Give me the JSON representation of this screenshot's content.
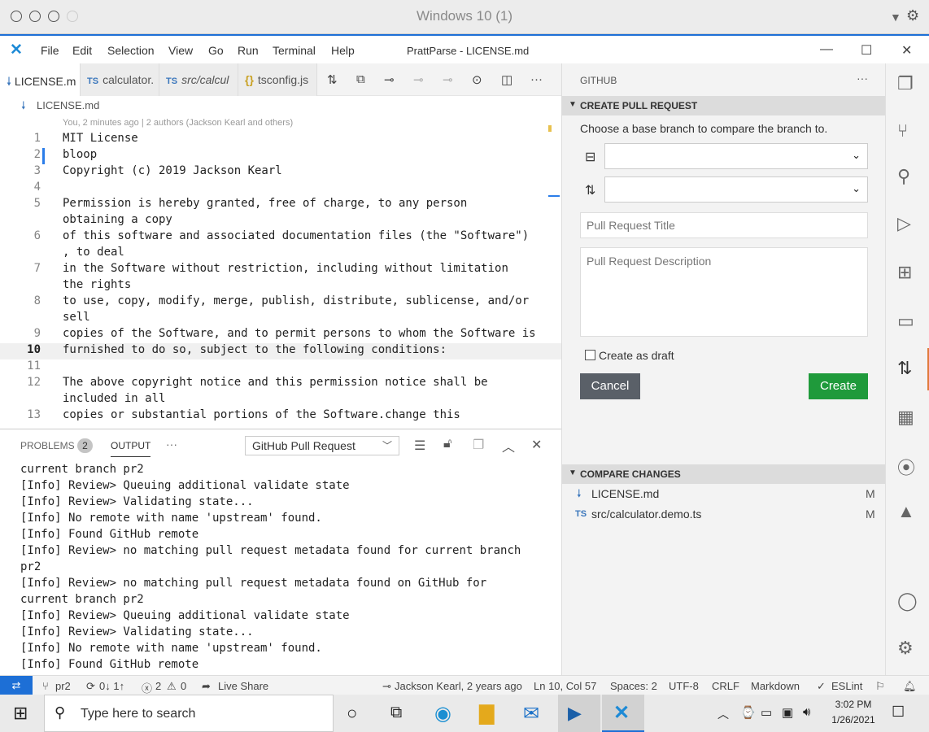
{
  "mac": {
    "title": "Windows 10 (1)"
  },
  "titlebar": {
    "menus": [
      "File",
      "Edit",
      "Selection",
      "View",
      "Go",
      "Run",
      "Terminal",
      "Help"
    ],
    "window_title": "PrattParse - LICENSE.md"
  },
  "tabs": [
    {
      "prefix": "",
      "label": "LICENSE.m"
    },
    {
      "prefix": "TS",
      "label": "calculator."
    },
    {
      "prefix": "TS",
      "label": "src/calcul"
    },
    {
      "prefix": "{}",
      "label": "tsconfig.js"
    }
  ],
  "breadcrumb": {
    "file": "LICENSE.md"
  },
  "editor": {
    "blame": "You, 2 minutes ago | 2 authors (Jackson Kearl and others)",
    "lines": [
      {
        "n": "1",
        "t": "MIT License"
      },
      {
        "n": "2",
        "t": "bloop"
      },
      {
        "n": "3",
        "t": "Copyright (c) 2019 Jackson Kearl"
      },
      {
        "n": "4",
        "t": ""
      },
      {
        "n": "5",
        "t": "Permission is hereby granted, free of charge, to any person"
      },
      {
        "n": "",
        "t": "obtaining a copy"
      },
      {
        "n": "6",
        "t": "of this software and associated documentation files (the \"Software\")"
      },
      {
        "n": "",
        "t": ", to deal"
      },
      {
        "n": "7",
        "t": "in the Software without restriction, including without limitation"
      },
      {
        "n": "",
        "t": "the rights"
      },
      {
        "n": "8",
        "t": "to use, copy, modify, merge, publish, distribute, sublicense, and/or"
      },
      {
        "n": "",
        "t": "sell"
      },
      {
        "n": "9",
        "t": "copies of the Software, and to permit persons to whom the Software is"
      },
      {
        "n": "10",
        "t": "furnished to do so, subject to the following conditions:"
      },
      {
        "n": "11",
        "t": ""
      },
      {
        "n": "12",
        "t": "The above copyright notice and this permission notice shall be"
      },
      {
        "n": "",
        "t": "included in all"
      },
      {
        "n": "13",
        "t": "copies or substantial portions of the Software.change this"
      }
    ]
  },
  "panel": {
    "problems_label": "PROBLEMS",
    "problems_count": "2",
    "output_label": "OUTPUT",
    "more": "···",
    "channel": "GitHub Pull Request",
    "lines": [
      "current branch pr2",
      "[Info] Review> Queuing additional validate state",
      "[Info] Review> Validating state...",
      "[Info] No remote with name 'upstream' found.",
      "[Info] Found GitHub remote",
      "[Info] Review> no matching pull request metadata found for current branch",
      "pr2",
      "[Info] Review> no matching pull request metadata found on GitHub for",
      "current branch pr2",
      "[Info] Review> Queuing additional validate state",
      "[Info] Review> Validating state...",
      "[Info] No remote with name 'upstream' found.",
      "[Info] Found GitHub remote"
    ]
  },
  "side": {
    "header": "GITHUB",
    "create_section": "CREATE PULL REQUEST",
    "instruction": "Choose a base branch to compare the branch to.",
    "title_placeholder": "Pull Request Title",
    "desc_placeholder": "Pull Request Description",
    "draft_label": "Create as draft",
    "cancel": "Cancel",
    "create": "Create",
    "compare_section": "COMPARE CHANGES",
    "changes": [
      {
        "prefix": "",
        "name": "LICENSE.md",
        "status": "M"
      },
      {
        "prefix": "TS",
        "name": "src/calculator.demo.ts",
        "status": "M"
      }
    ]
  },
  "status": {
    "branch": "pr2",
    "sync": "0↓ 1↑",
    "errors": "2",
    "warnings": "0",
    "liveshare": "Live Share",
    "blame": "Jackson Kearl, 2 years ago",
    "position": "Ln 10, Col 57",
    "spaces": "Spaces: 2",
    "encoding": "UTF-8",
    "eol": "CRLF",
    "language": "Markdown",
    "eslint": "ESLint"
  },
  "taskbar": {
    "search_placeholder": "Type here to search",
    "time": "3:02 PM",
    "date": "1/26/2021"
  },
  "colors": {
    "accent": "#1d6fd6",
    "create": "#1f9a3b",
    "cancel": "#5a6068"
  }
}
